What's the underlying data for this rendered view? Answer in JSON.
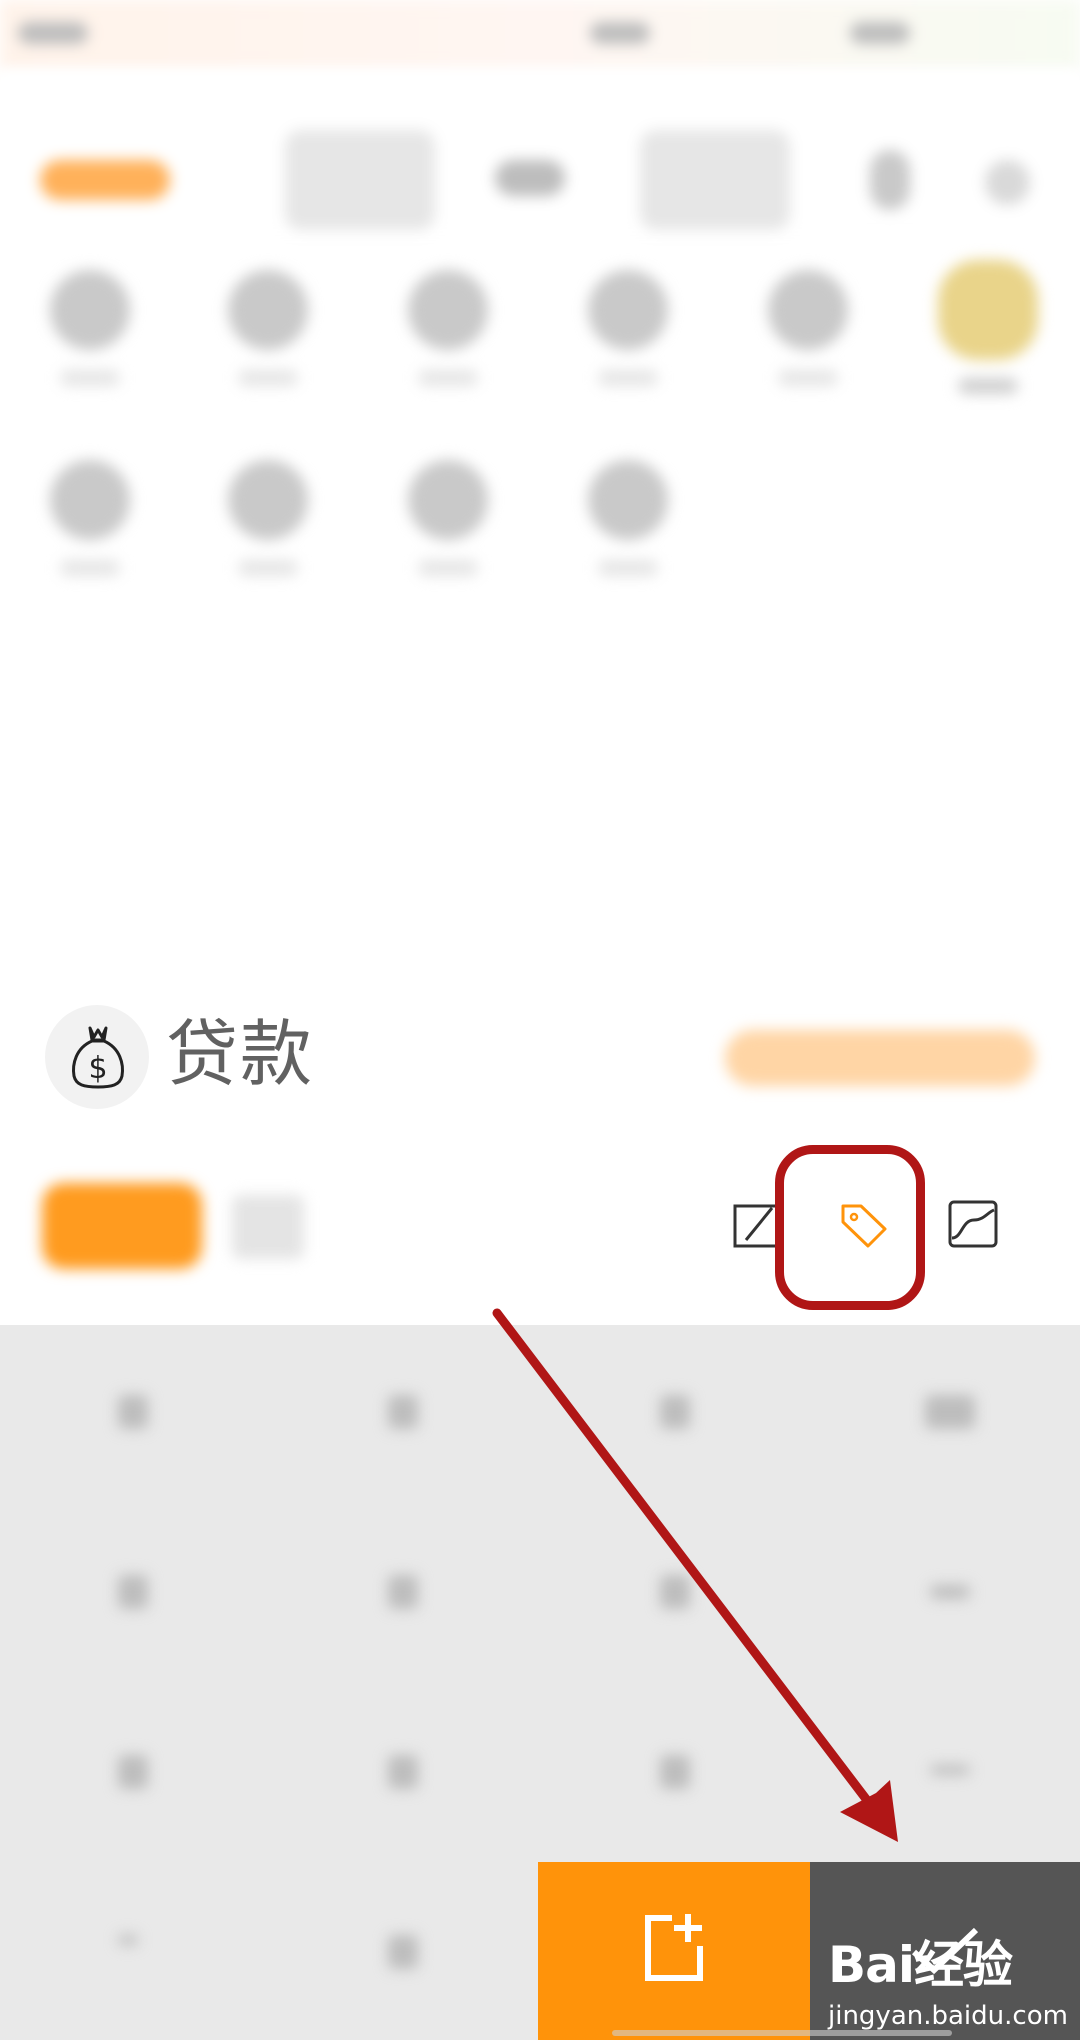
{
  "selected_category": {
    "label": "贷款",
    "icon": "money-bag-icon"
  },
  "toolbar_icons": [
    "note-edit-icon",
    "tag-icon",
    "image-icon"
  ],
  "highlighted_icon": "tag-icon",
  "actions": {
    "again_icon": "new-record-icon",
    "confirm_icon": "checkmark-icon"
  },
  "watermark": {
    "brand": "Bai经验",
    "url": "jingyan.baidu.com"
  },
  "colors": {
    "accent": "#ff930a",
    "annotation": "#b01616",
    "confirm_bg": "#555555"
  }
}
